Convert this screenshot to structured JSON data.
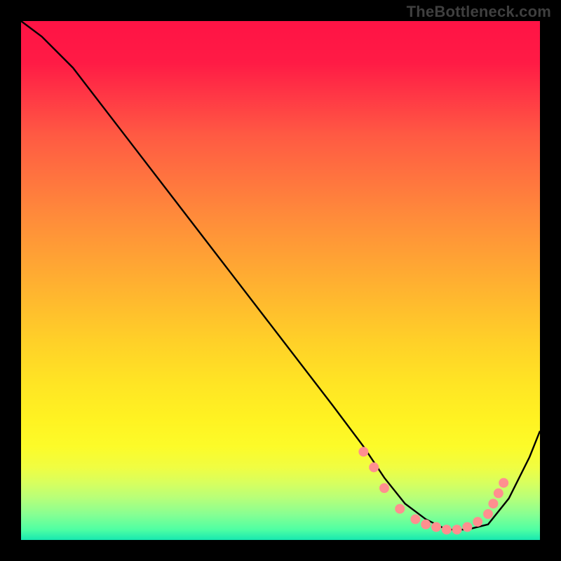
{
  "watermark": "TheBottleneck.com",
  "chart_data": {
    "type": "line",
    "title": "",
    "xlabel": "",
    "ylabel": "",
    "xlim": [
      0,
      100
    ],
    "ylim": [
      0,
      100
    ],
    "background_gradient": {
      "description": "vertical red→yellow→green gradient indicating bottleneck severity (red high, green low)",
      "stops": [
        {
          "pos": 0.0,
          "color": "#ff1345"
        },
        {
          "pos": 0.5,
          "color": "#ffc62a"
        },
        {
          "pos": 0.85,
          "color": "#f7fd30"
        },
        {
          "pos": 1.0,
          "color": "#17e8b0"
        }
      ]
    },
    "series": [
      {
        "name": "bottleneck-curve",
        "color": "#000000",
        "x": [
          0,
          4,
          10,
          20,
          30,
          40,
          50,
          60,
          66,
          70,
          74,
          78,
          82,
          86,
          90,
          94,
          98,
          100
        ],
        "y": [
          100,
          97,
          91,
          78,
          65,
          52,
          39,
          26,
          18,
          12,
          7,
          4,
          2,
          2,
          3,
          8,
          16,
          21
        ]
      }
    ],
    "markers": {
      "name": "highlighted-points",
      "color": "#ff8f8f",
      "radius": 7,
      "points": [
        {
          "x": 66,
          "y": 17
        },
        {
          "x": 68,
          "y": 14
        },
        {
          "x": 70,
          "y": 10
        },
        {
          "x": 73,
          "y": 6
        },
        {
          "x": 76,
          "y": 4
        },
        {
          "x": 78,
          "y": 3
        },
        {
          "x": 80,
          "y": 2.5
        },
        {
          "x": 82,
          "y": 2
        },
        {
          "x": 84,
          "y": 2
        },
        {
          "x": 86,
          "y": 2.5
        },
        {
          "x": 88,
          "y": 3.5
        },
        {
          "x": 90,
          "y": 5
        },
        {
          "x": 91,
          "y": 7
        },
        {
          "x": 92,
          "y": 9
        },
        {
          "x": 93,
          "y": 11
        }
      ]
    }
  }
}
